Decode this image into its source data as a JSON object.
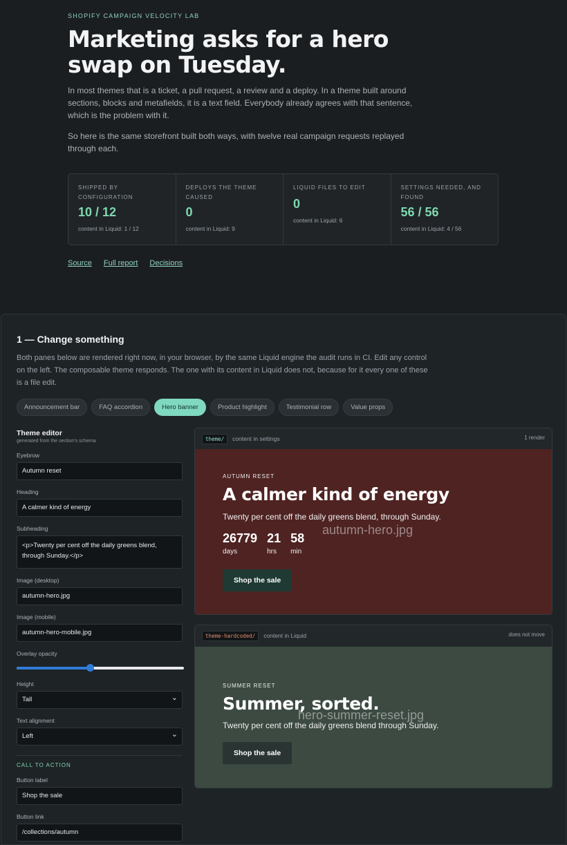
{
  "header": {
    "eyebrow": "SHOPIFY CAMPAIGN VELOCITY LAB",
    "title": "Marketing asks for a hero swap on Tuesday.",
    "paragraph1": "In most themes that is a ticket, a pull request, a review and a deploy. In a theme built around sections, blocks and metafields, it is a text field. Everybody already agrees with that sentence, which is the problem with it.",
    "paragraph2": "So here is the same storefront built both ways, with twelve real campaign requests replayed through each."
  },
  "stats": [
    {
      "label": "SHIPPED BY CONFIGURATION",
      "value": "10 / 12",
      "sub": "content in Liquid: 1 / 12"
    },
    {
      "label": "DEPLOYS THE THEME CAUSED",
      "value": "0",
      "sub": "content in Liquid: 9"
    },
    {
      "label": "LIQUID FILES TO EDIT",
      "value": "0",
      "sub": "content in Liquid: 6"
    },
    {
      "label": "SETTINGS NEEDED, AND FOUND",
      "value": "56 / 56",
      "sub": "content in Liquid: 4 / 56"
    }
  ],
  "links": [
    "Source",
    "Full report",
    "Decisions"
  ],
  "section": {
    "title": "1 — Change something",
    "description": "Both panes below are rendered right now, in your browser, by the same Liquid engine the audit runs in CI. Edit any control on the left. The composable theme responds. The one with its content in Liquid does not, because for it every one of these is a file edit."
  },
  "chips": [
    "Announcement bar",
    "FAQ accordion",
    "Hero banner",
    "Product highlight",
    "Testimonial row",
    "Value props"
  ],
  "active_chip": "Hero banner",
  "editor": {
    "title": "Theme editor",
    "subtitle": "generated from the section's schema",
    "eyebrow_label": "Eyebrow",
    "eyebrow_value": "Autumn reset",
    "heading_label": "Heading",
    "heading_value": "A calmer kind of energy",
    "subheading_label": "Subheading",
    "subheading_value": "<p>Twenty per cent off the daily greens blend, through Sunday.</p>",
    "image_desktop_label": "Image (desktop)",
    "image_desktop_value": "autumn-hero.jpg",
    "image_mobile_label": "Image (mobile)",
    "image_mobile_value": "autumn-hero-mobile.jpg",
    "opacity_label": "Overlay opacity",
    "opacity_value": 0.44,
    "height_label": "Height",
    "height_value": "Tall",
    "align_label": "Text alignment",
    "align_value": "Left",
    "cta_heading": "CALL TO ACTION",
    "button_label_label": "Button label",
    "button_label_value": "Shop the sale",
    "button_link_label": "Button link",
    "button_link_value": "/collections/autumn"
  },
  "preview1": {
    "tag": "theme/",
    "note": "content in settings",
    "right": "1 render",
    "eyebrow": "AUTUMN RESET",
    "heading": "A calmer kind of energy",
    "sub": "Twenty per cent off the daily greens blend, through Sunday.",
    "image": "autumn-hero.jpg",
    "countdown": [
      {
        "num": "26779",
        "lbl": "days"
      },
      {
        "num": "21",
        "lbl": "hrs"
      },
      {
        "num": "58",
        "lbl": "min"
      }
    ],
    "button": "Shop the sale",
    "bg": "#4f2322"
  },
  "preview2": {
    "tag": "theme-hardcoded/",
    "note": "content in Liquid",
    "right": "does not move",
    "eyebrow": "SUMMER RESET",
    "heading": "Summer, sorted.",
    "sub": "Twenty per cent off the daily greens blend through Sunday.",
    "image": "hero-summer-reset.jpg",
    "button": "Shop the sale",
    "bg": "#3c4a42"
  },
  "colors": {
    "accent": "#7fd8c0",
    "stat_value": "#7fd8b0",
    "page_bg": "#1b1e20"
  }
}
